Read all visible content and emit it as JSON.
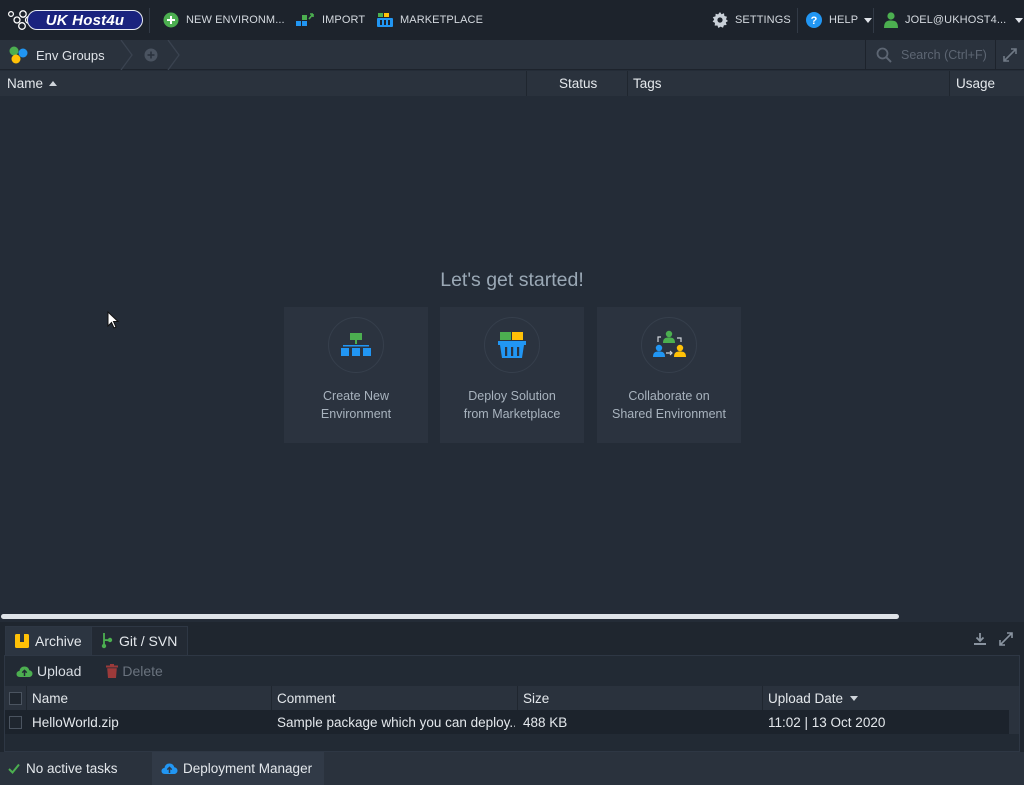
{
  "app": {
    "logo_text": "UK Host4u",
    "colors": {
      "bg": "#242c37",
      "topbar": "#1d232c",
      "accent_green": "#4caf50",
      "accent_blue": "#2196f3"
    }
  },
  "topbar": {
    "new_env_label": "NEW ENVIRONM...",
    "import_label": "IMPORT",
    "marketplace_label": "MARKETPLACE",
    "settings_label": "SETTINGS",
    "help_label": "HELP",
    "user_label": "JOEL@UKHOST4..."
  },
  "breadcrumb": {
    "root_label": "Env Groups",
    "search_placeholder": "Search (Ctrl+F)"
  },
  "grid": {
    "columns": [
      "Name",
      "Status",
      "Tags",
      "Usage"
    ]
  },
  "empty_state": {
    "heading": "Let's get started!",
    "cards": [
      {
        "line1": "Create New",
        "line2": "Environment",
        "icon": "create-environment-icon"
      },
      {
        "line1": "Deploy Solution",
        "line2": "from Marketplace",
        "icon": "marketplace-icon"
      },
      {
        "line1": "Collaborate on",
        "line2": "Shared Environment",
        "icon": "collaborate-icon"
      }
    ]
  },
  "deploy_panel": {
    "tabs": [
      "Archive",
      "Git / SVN"
    ],
    "toolbar": {
      "upload_label": "Upload",
      "delete_label": "Delete"
    },
    "columns": [
      "Name",
      "Comment",
      "Size",
      "Upload Date"
    ],
    "rows": [
      {
        "name": "HelloWorld.zip",
        "comment": "Sample package which you can deploy...",
        "size": "488 KB",
        "date": "11:02 | 13 Oct 2020"
      }
    ]
  },
  "statusbar": {
    "tasks_label": "No active tasks",
    "deployment_label": "Deployment Manager"
  }
}
